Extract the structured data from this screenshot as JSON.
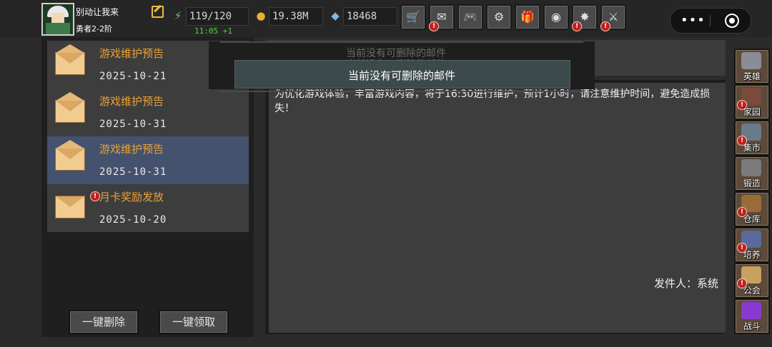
{
  "player": {
    "name": "别动让我来",
    "title": "勇者2-2阶"
  },
  "stats": {
    "stamina": "119/120",
    "gold": "19.38M",
    "gems": "18468",
    "timer": "11:05 +1"
  },
  "toolbar": [
    {
      "name": "shop-cart-icon",
      "glyph": "🛒",
      "badge": false
    },
    {
      "name": "mail-icon",
      "glyph": "✉",
      "badge": true
    },
    {
      "name": "gamepad-icon",
      "glyph": "🎮",
      "badge": false
    },
    {
      "name": "settings-gear-icon",
      "glyph": "⚙",
      "badge": false
    },
    {
      "name": "gift-box-icon",
      "glyph": "🎁",
      "badge": false
    },
    {
      "name": "lucky-wheel-icon",
      "glyph": "◉",
      "badge": false
    },
    {
      "name": "firework-icon",
      "glyph": "✸",
      "badge": true
    },
    {
      "name": "crossed-swords-icon",
      "glyph": "⚔",
      "badge": true
    }
  ],
  "mails": [
    {
      "title": "游戏维护预告",
      "date": "2025-10-21",
      "opened": true,
      "selected": false,
      "badge": false
    },
    {
      "title": "游戏维护预告",
      "date": "2025-10-31",
      "opened": true,
      "selected": false,
      "badge": false
    },
    {
      "title": "游戏维护预告",
      "date": "2025-10-31",
      "opened": true,
      "selected": true,
      "badge": false
    },
    {
      "title": "月卡奖励发放",
      "date": "2025-10-20",
      "opened": false,
      "selected": false,
      "badge": true
    }
  ],
  "buttons": {
    "delete_all": "一键删除",
    "claim_all": "一键领取"
  },
  "mail_content": {
    "body": "为优化游戏体验，丰富游戏内容，将于16:30进行维护，预计1小时，请注意维护时间，避免造成损失！",
    "sender": "发件人：系统"
  },
  "toast": {
    "message": "当前没有可删除的邮件",
    "ghost_1": "当前没有可删除的邮件",
    "ghost_2": "当前没有可删除的邮件"
  },
  "side_menu": [
    {
      "label": "英雄",
      "icon": "knight-helmet-icon",
      "color": "#8c8c96",
      "badge": false
    },
    {
      "label": "家园",
      "icon": "castle-icon",
      "color": "#7a4a3a",
      "badge": true
    },
    {
      "label": "集市",
      "icon": "market-stall-icon",
      "color": "#6a7a8a",
      "badge": true
    },
    {
      "label": "锻造",
      "icon": "anvil-icon",
      "color": "#7a7a7a",
      "badge": false
    },
    {
      "label": "仓库",
      "icon": "treasure-chest-icon",
      "color": "#9a6a3a",
      "badge": true
    },
    {
      "label": "培养",
      "icon": "potion-icon",
      "color": "#5a6a9a",
      "badge": true
    },
    {
      "label": "公会",
      "icon": "guild-lion-icon",
      "color": "#c8a060",
      "badge": true
    },
    {
      "label": "战斗",
      "icon": "portal-icon",
      "color": "#8a3ad0",
      "badge": false
    }
  ]
}
